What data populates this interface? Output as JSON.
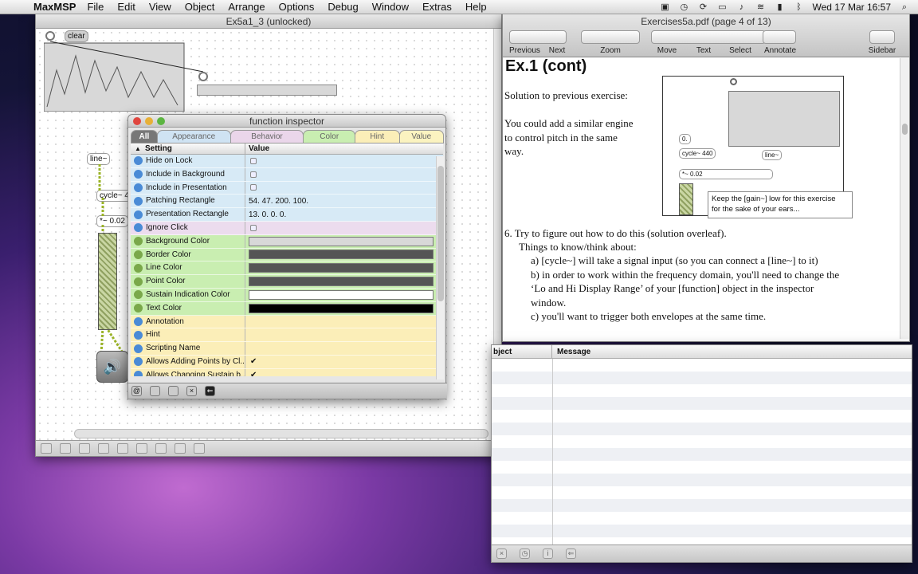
{
  "menubar": {
    "app": "MaxMSP",
    "items": [
      "File",
      "Edit",
      "View",
      "Object",
      "Arrange",
      "Options",
      "Debug",
      "Window",
      "Extras",
      "Help"
    ],
    "clock": "Wed 17 Mar  16:57"
  },
  "patcher": {
    "title": "Ex5a1_3 (unlocked)",
    "objects": {
      "clear": "clear",
      "line": "line~",
      "cycle": "cycle~ 4",
      "mult": "*~ 0.02"
    }
  },
  "inspector": {
    "title": "function inspector",
    "tabs": [
      "All",
      "Appearance",
      "Behavior",
      "Color",
      "Hint",
      "Value"
    ],
    "columns": {
      "setting": "Setting",
      "value": "Value"
    },
    "rows": [
      {
        "label": "Hide on Lock",
        "value": "",
        "type": "check",
        "checked": false,
        "cat": "behavior"
      },
      {
        "label": "Include in Background",
        "value": "",
        "type": "check",
        "checked": false,
        "cat": "behavior"
      },
      {
        "label": "Include in Presentation",
        "value": "",
        "type": "check",
        "checked": false,
        "cat": "behavior"
      },
      {
        "label": "Patching Rectangle",
        "value": "54. 47. 200. 100.",
        "type": "text",
        "cat": "behavior"
      },
      {
        "label": "Presentation Rectangle",
        "value": "13. 0. 0. 0.",
        "type": "text",
        "cat": "behavior"
      },
      {
        "label": "Ignore Click",
        "value": "",
        "type": "check",
        "checked": false,
        "cat": "pink"
      },
      {
        "label": "Background Color",
        "value": "#d8d8d8",
        "type": "color",
        "cat": "color"
      },
      {
        "label": "Border Color",
        "value": "#555555",
        "type": "color",
        "cat": "color"
      },
      {
        "label": "Line Color",
        "value": "#555555",
        "type": "color",
        "cat": "color"
      },
      {
        "label": "Point Color",
        "value": "#555555",
        "type": "color",
        "cat": "color"
      },
      {
        "label": "Sustain Indication Color",
        "value": "#ffffff",
        "type": "color",
        "cat": "color"
      },
      {
        "label": "Text Color",
        "value": "#000000",
        "type": "color",
        "cat": "color"
      },
      {
        "label": "Annotation",
        "value": "",
        "type": "text",
        "cat": "hint"
      },
      {
        "label": "Hint",
        "value": "",
        "type": "text",
        "cat": "hint"
      },
      {
        "label": "Scripting Name",
        "value": "",
        "type": "text",
        "cat": "hint"
      },
      {
        "label": "Allows Adding Points by Cl...",
        "value": "",
        "type": "check",
        "checked": true,
        "cat": "hint"
      },
      {
        "label": "Allows Changing Sustain b...",
        "value": "",
        "type": "check",
        "checked": true,
        "cat": "hint"
      }
    ]
  },
  "pdf": {
    "title": "Exercises5a.pdf (page 4 of 13)",
    "toolbar": [
      "Previous",
      "Next",
      "Zoom",
      "Move",
      "Text",
      "Select",
      "Annotate",
      "Sidebar"
    ],
    "heading": "Ex.1 (cont)",
    "para1": "Solution to previous exercise:",
    "para2": [
      "You could add a similar engine",
      "to control pitch in the same",
      "way."
    ],
    "diagram": {
      "box1": "0.",
      "cycle": "cycle~ 440",
      "line": "line~",
      "mult": "*~ 0.02",
      "note": [
        "Keep the [gain~] low for this exercise",
        "for the sake of your ears..."
      ]
    },
    "item6": "6. Try to figure out how to do this (solution overleaf).",
    "things": "Things to know/think about:",
    "a": "a) [cycle~] will take a signal input (so you can connect a [line~] to it)",
    "b1": "b) in order to work within the frequency domain, you'll need to change the",
    "b2": "‘Lo and Hi Display Range’ of your [function] object in the inspector",
    "b3": "window.",
    "c": "c) you'll want to trigger both envelopes at the same time."
  },
  "console": {
    "columns": [
      "bject",
      "Message"
    ]
  },
  "colors": {
    "behavior": "#d7eaf6",
    "pink": "#ecdcee",
    "color": "#c9eeb1",
    "hint": "#fbeeb8",
    "dot_blue": "#4a8bd6",
    "dot_green": "#7aa84a"
  }
}
